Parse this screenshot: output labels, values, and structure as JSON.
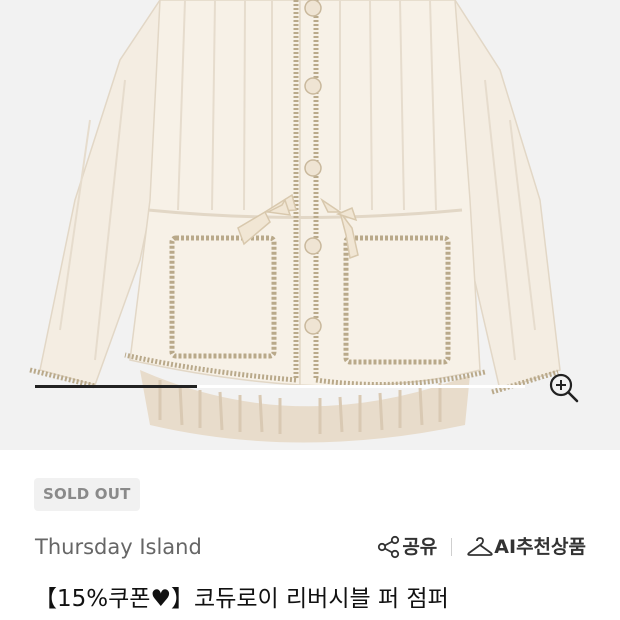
{
  "product": {
    "image_alt": "Ivory quilted reversible corduroy fur jacket",
    "gallery_progress_fraction": 0.33,
    "status_badge": "SOLD OUT",
    "brand": "Thursday Island",
    "title": "【15%쿠폰♥】코듀로이 리버시블 퍼 점퍼"
  },
  "actions": {
    "share_label": "공유",
    "share_icon": "share-icon",
    "ai_label": "AI추천상품",
    "ai_icon": "hanger-icon"
  },
  "icons": {
    "zoom": "zoom-in-icon"
  },
  "colors": {
    "jacket": "#f4ede2",
    "trim": "#b9a98a",
    "badge_bg": "#f1f1f1",
    "badge_text": "#8a8a8a"
  }
}
